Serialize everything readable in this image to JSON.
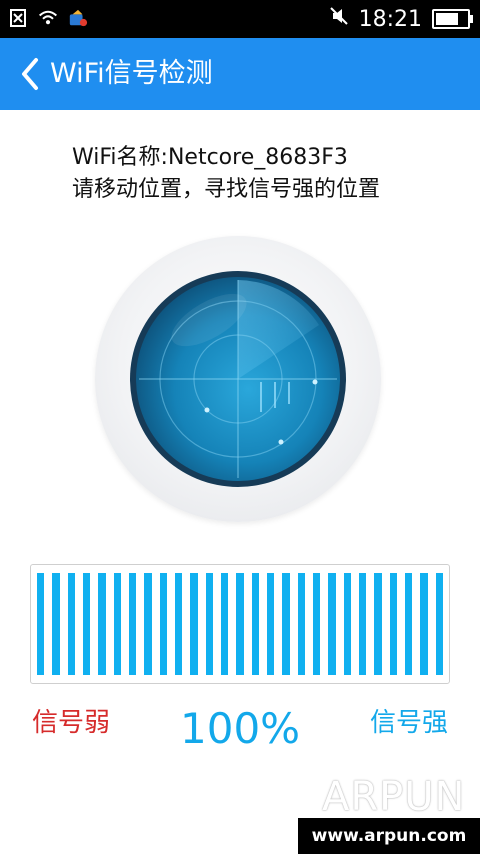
{
  "status": {
    "time": "18:21",
    "battery_level": 0.8
  },
  "header": {
    "title": "WiFi信号检测",
    "back_icon": "chevron-left-icon"
  },
  "info": {
    "line1": "WiFi名称:Netcore_8683F3",
    "line2": "请移动位置，寻找信号强的位置"
  },
  "meter": {
    "bar_count": 27,
    "bar_color": "#10b0f0"
  },
  "labels": {
    "weak": "信号弱",
    "strong": "信号强",
    "percent": "100%"
  },
  "watermark": {
    "logo": "ARPUN",
    "url": "www.arpun.com"
  },
  "colors": {
    "appbar": "#1f8ef0",
    "weak": "#d62b2b",
    "strong": "#13a8ea"
  }
}
